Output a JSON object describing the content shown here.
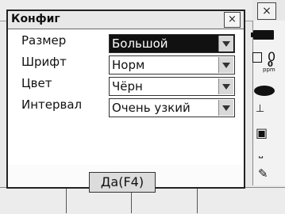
{
  "dialog": {
    "title": "Конфиг",
    "close_glyph": "×",
    "ok_label": "Да(F4)",
    "rows": [
      {
        "label": "Размер",
        "value": "Большой",
        "selected": true
      },
      {
        "label": "Шрифт",
        "value": "Норм",
        "selected": false
      },
      {
        "label": "Цвет",
        "value": "Чёрн",
        "selected": false
      },
      {
        "label": "Интервал",
        "value": "Очень узкий",
        "selected": false
      }
    ]
  },
  "background": {
    "close_glyph": "×",
    "status": {
      "distance_offset": "0",
      "ppm_value": "0",
      "ppm_unit": "ppm",
      "icons": [
        "battery-icon",
        "prism-constant-icon",
        "ppm-icon",
        "laser-eye-icon",
        "tilt-icon",
        "target-icon",
        "level-icon",
        "edit-icon"
      ]
    }
  }
}
